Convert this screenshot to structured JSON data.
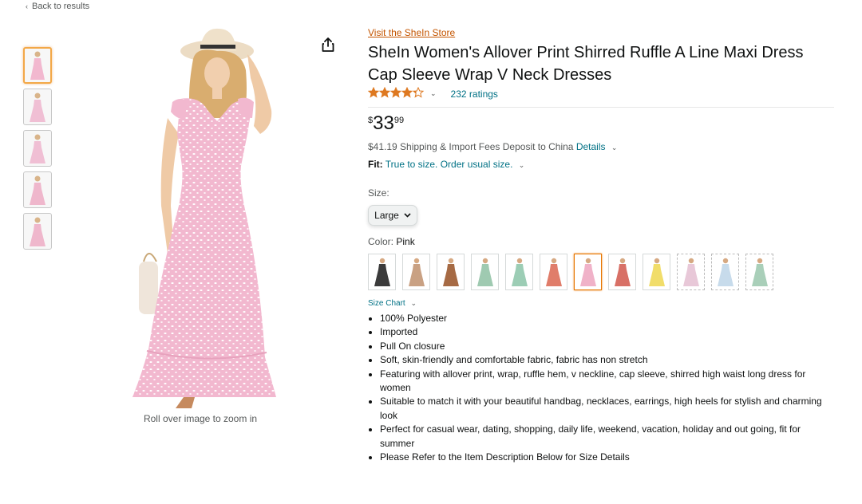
{
  "nav": {
    "back": "Back to results"
  },
  "gallery": {
    "zoom_hint": "Roll over image to zoom in",
    "thumbnail_dress_colors": [
      "#f2b8cf",
      "#f0bfd4",
      "#f0bfd4",
      "#efb7cc",
      "#efb7cc"
    ]
  },
  "product": {
    "store_link": "Visit the SheIn Store",
    "title": "SheIn Women's Allover Print Shirred Ruffle A Line Maxi Dress Cap Sleeve Wrap V Neck Dresses",
    "rating_value": 4.3,
    "ratings_count": "232 ratings",
    "price": {
      "symbol": "$",
      "whole": "33",
      "fraction": "99"
    },
    "shipping": {
      "text": "$41.19 Shipping & Import Fees Deposit to China",
      "details": "Details"
    },
    "fit": {
      "label": "Fit:",
      "value": "True to size. Order usual size."
    },
    "size": {
      "label": "Size:",
      "selected": "Large"
    },
    "color": {
      "label": "Color:",
      "selected": "Pink"
    },
    "swatch_colors": [
      "#3b3b3b",
      "#c9a183",
      "#a66a44",
      "#9fcab1",
      "#9ccdb5",
      "#e07d6a",
      "#f0b2c8",
      "#d87066",
      "#f1dd6a",
      "#e8c8d8",
      "#c7dbeb",
      "#a9cfb9"
    ],
    "selected_swatch": 6,
    "size_chart": "Size Chart",
    "bullets": [
      "100% Polyester",
      "Imported",
      "Pull On closure",
      "Soft, skin-friendly and comfortable fabric, fabric has non stretch",
      "Featuring with allover print, wrap, ruffle hem, v neckline, cap sleeve, shirred high waist long dress for women",
      "Suitable to match it with your beautiful handbag, necklaces, earrings, high heels for stylish and charming look",
      "Perfect for casual wear, dating, shopping, daily life, weekend, vacation, holiday and out going, fit for summer",
      "Please Refer to the Item Description Below for Size Details"
    ]
  },
  "colors": {
    "link": "#007185",
    "store": "#c45500",
    "star": "#de7921",
    "dress": "#f2b8cf"
  }
}
